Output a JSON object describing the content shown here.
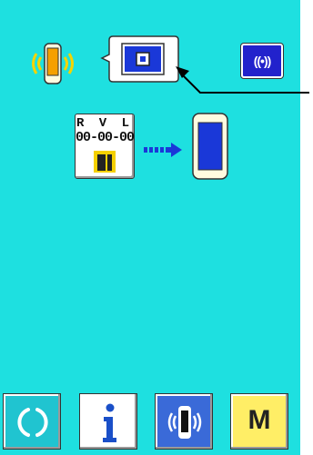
{
  "status": {
    "version_letters": "R V L",
    "version_digits": "00-00-00"
  },
  "signal_button": {
    "label": "((•))"
  },
  "bottom_bar": {
    "mode_label": "M"
  },
  "colors": {
    "background": "#1ee0e0",
    "accent_blue": "#2222cc",
    "device_orange": "#f5a000",
    "mode_yellow": "#ffee66"
  },
  "icons": [
    "comm-device-icon",
    "data-card-icon",
    "signal-icon",
    "sd-card-icon",
    "transfer-arrow-icon",
    "target-device-icon",
    "reset-icon",
    "info-icon",
    "communication-icon"
  ]
}
